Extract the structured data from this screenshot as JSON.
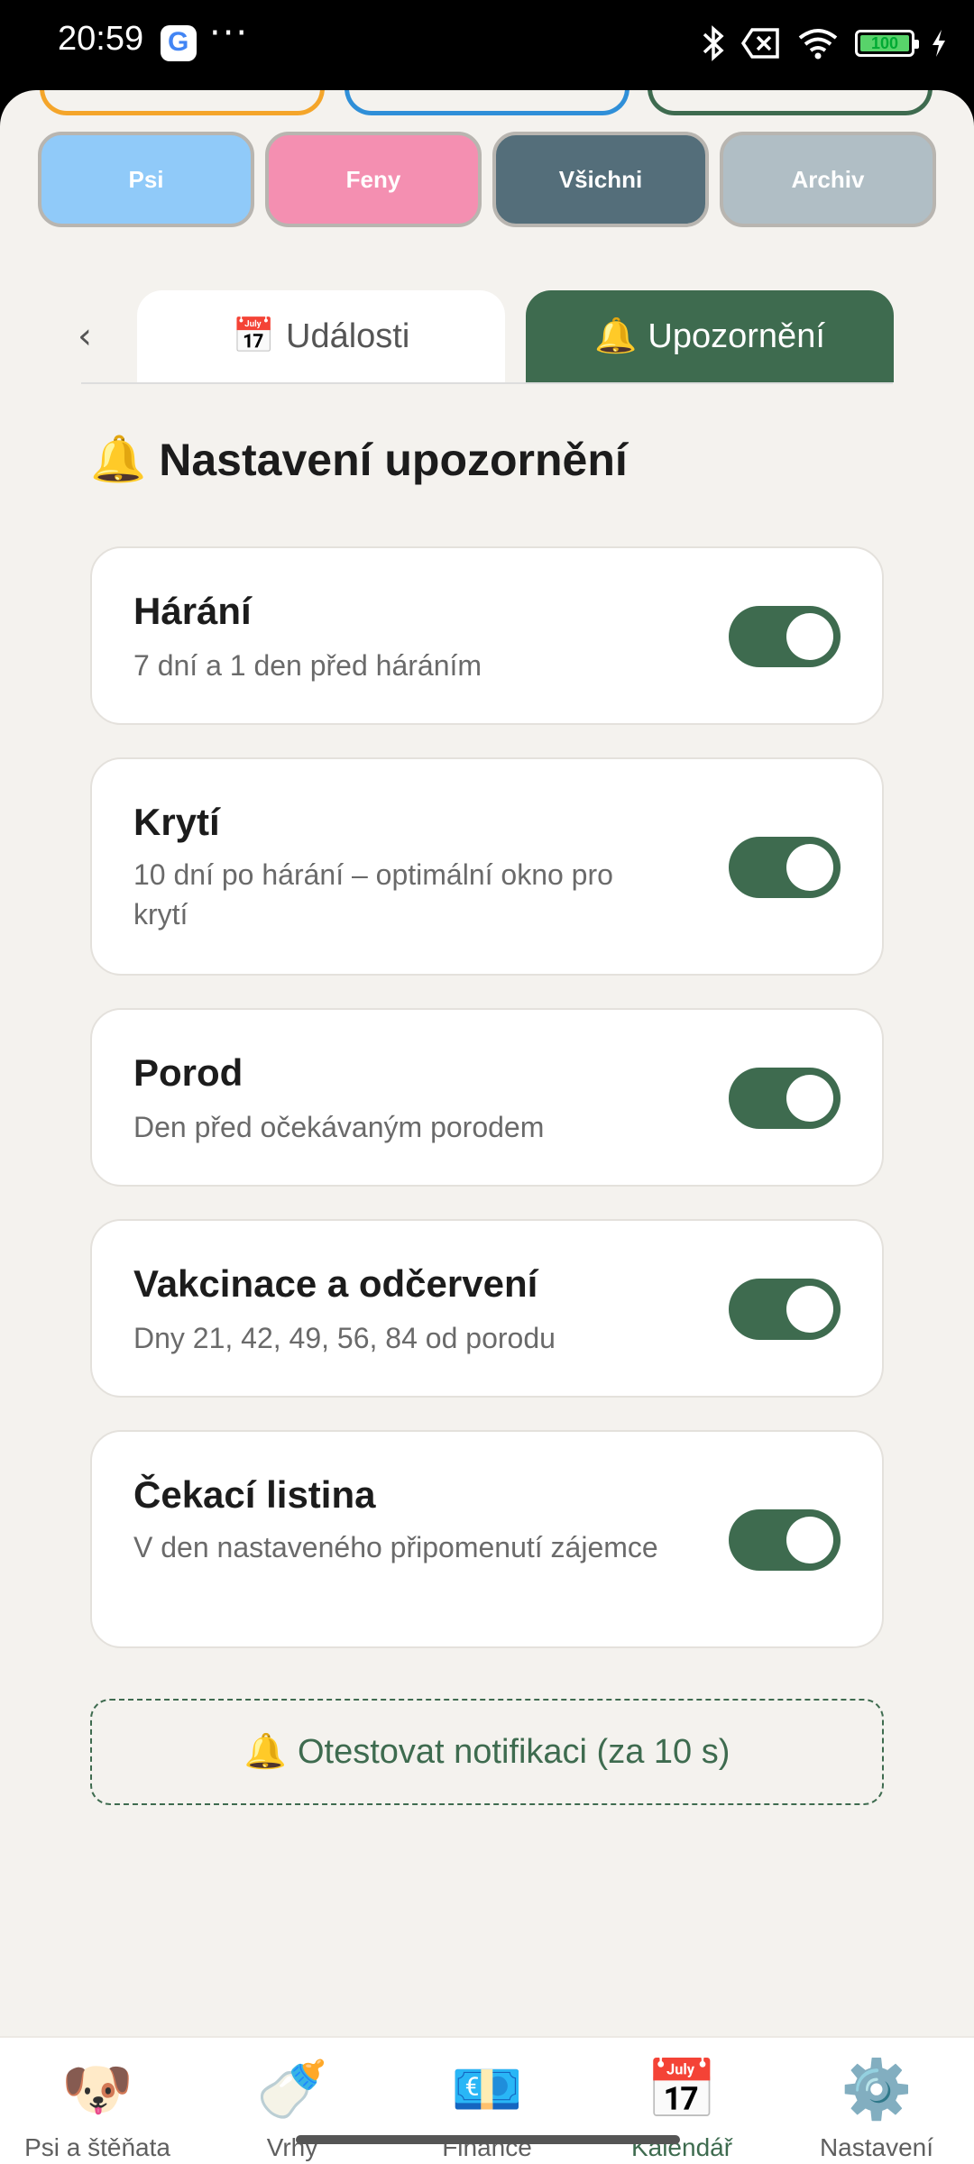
{
  "status": {
    "time": "20:59",
    "battery": "100"
  },
  "filters": [
    {
      "label": "Psi",
      "color": "#90caf9"
    },
    {
      "label": "Feny",
      "color": "#f48fb1"
    },
    {
      "label": "Všichni",
      "color": "#546e7a"
    },
    {
      "label": "Archiv",
      "color": "#b0bec5"
    }
  ],
  "tabs": {
    "back": "‹",
    "events": {
      "icon": "📅",
      "label": "Události"
    },
    "alerts": {
      "icon": "🔔",
      "label": "Upozornění"
    }
  },
  "section": {
    "icon": "🔔",
    "title": "Nastavení upozornění"
  },
  "notifications": [
    {
      "title": "Hárání",
      "desc": "7 dní a 1 den před háráním",
      "enabled": true
    },
    {
      "title": "Krytí",
      "desc": "10 dní po hárání – optimální okno pro krytí",
      "enabled": true
    },
    {
      "title": "Porod",
      "desc": "Den před očekávaným porodem",
      "enabled": true
    },
    {
      "title": "Vakcinace a odčervení",
      "desc": "Dny 21, 42, 49, 56, 84 od porodu",
      "enabled": true
    },
    {
      "title": "Čekací listina",
      "desc": "V den nastaveného připomenutí zájemce",
      "enabled": true
    }
  ],
  "test_button": {
    "icon": "🔔",
    "label": "Otestovat notifikaci (za 10 s)"
  },
  "nav": [
    {
      "icon": "🐶",
      "label": "Psi a štěňata"
    },
    {
      "icon": "🍼",
      "label": "Vrhy"
    },
    {
      "icon": "💶",
      "label": "Finance"
    },
    {
      "icon": "📅",
      "label": "Kalendář",
      "active": true
    },
    {
      "icon": "⚙️",
      "label": "Nastavení"
    }
  ]
}
